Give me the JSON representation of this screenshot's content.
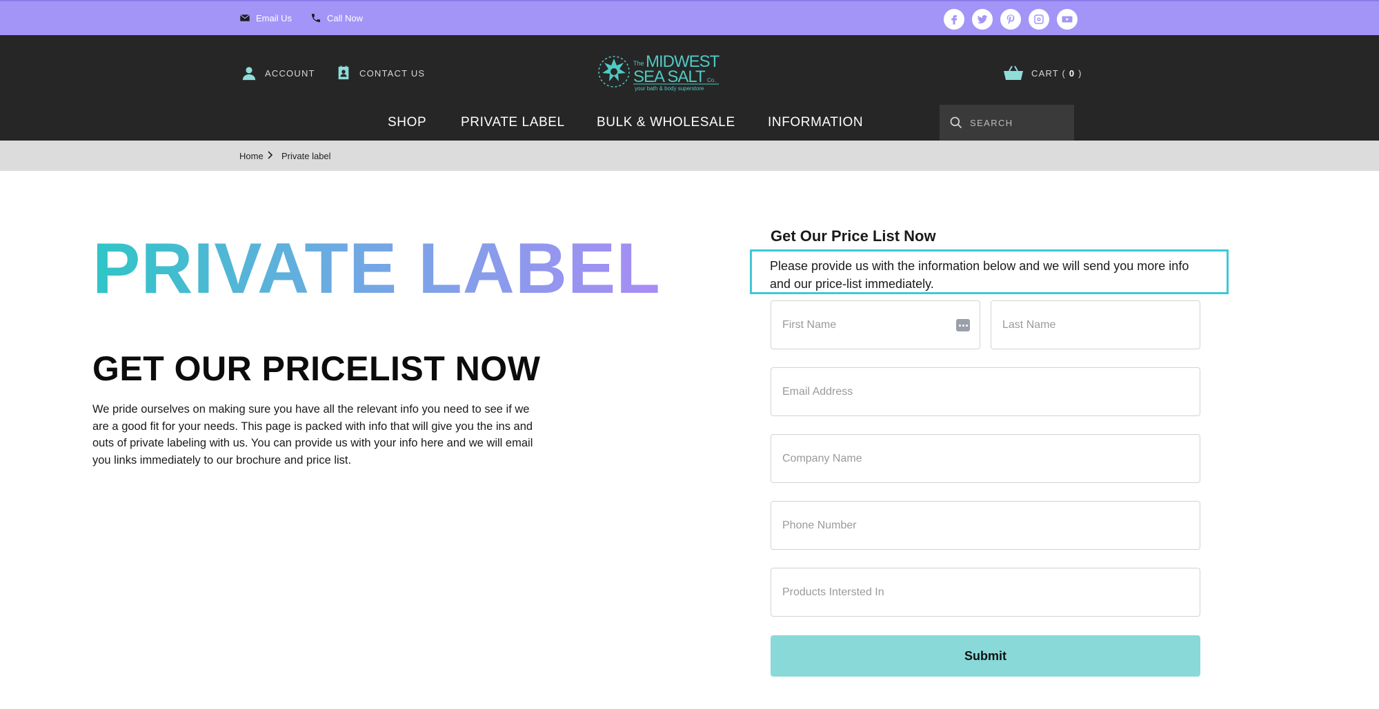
{
  "topbar": {
    "email_label": "Email Us",
    "call_label": "Call Now",
    "social": [
      "facebook-icon",
      "twitter-icon",
      "pinterest-icon",
      "instagram-icon",
      "youtube-icon"
    ]
  },
  "header": {
    "account_label": "ACCOUNT",
    "contact_label": "CONTACT US",
    "logo_alt": "The MIDWEST SEA SALT Co. your bath & body superstore",
    "cart_label": "CART (",
    "cart_count": "0",
    "cart_close": ")",
    "nav": [
      "SHOP",
      "PRIVATE LABEL",
      "BULK & WHOLESALE",
      "INFORMATION"
    ],
    "search_placeholder": "SEARCH"
  },
  "breadcrumb": {
    "home": "Home",
    "current": "Private label"
  },
  "hero": {
    "title": "PRIVATE LABEL",
    "subtitle": "GET OUR PRICELIST NOW",
    "intro": "We pride ourselves on making sure you have all the relevant info you need to see if we are a good fit for your needs. This page is packed with info that will give you the ins and outs of private labeling with us. You can provide us with your info here and we will email you links immediately to our brochure and price list."
  },
  "form": {
    "title": "Get Our Price List Now",
    "description": "Please provide us with the information below and we will send you more info and our price-list immediately.",
    "first_name": "First Name",
    "last_name": "Last Name",
    "email": "Email Address",
    "company": "Company Name",
    "phone": "Phone Number",
    "products": "Products Intersted In",
    "submit": "Submit"
  },
  "colors": {
    "topbar": "#a395f7",
    "header": "#262626",
    "accent_teal": "#8ad9d9",
    "highlight_border": "#3ec8d6"
  }
}
